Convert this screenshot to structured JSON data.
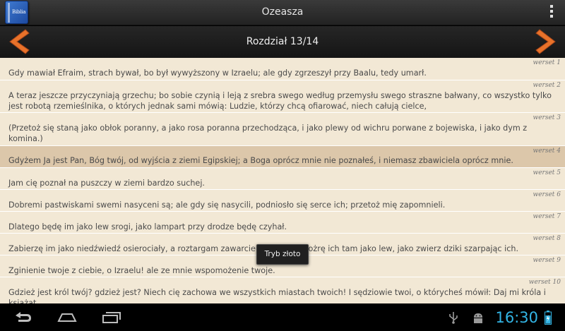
{
  "app": {
    "icon_text": "Biblia",
    "title": "Ozeasza"
  },
  "nav": {
    "chapter": "Rozdział 13/14"
  },
  "verses": [
    {
      "num": "werset 1",
      "text": "Gdy mawiał Efraim, strach bywał, bo był wywyższony w Izraelu; ale gdy zgrzeszył przy Baalu, tedy umarł."
    },
    {
      "num": "werset 2",
      "text": "A teraz jeszcze przyczyniają grzechu; bo sobie czynią i leją z srebra swego według przemysłu swego straszne bałwany, co wszystko tylko jest robotą rzemieślnika, o których jednak sami mówią: Ludzie, którzy chcą ofiarować, niech całują cielce,"
    },
    {
      "num": "werset 3",
      "text": "(Przetoż się staną jako obłok poranny, a jako rosa poranna przechodząca, i jako plewy od wichru porwane z bojewiska, i jako dym z komina.)"
    },
    {
      "num": "werset 4",
      "text": "Gdyżem Ja jest Pan, Bóg twój, od wyjścia z ziemi Egipskiej; a Boga oprócz mnie nie poznałeś, i niemasz zbawiciela oprócz mnie."
    },
    {
      "num": "werset 5",
      "text": "Jam cię poznał na puszczy w ziemi bardzo suchej."
    },
    {
      "num": "werset 6",
      "text": "Dobremi pastwiskami swemi nasyceni są; ale gdy się nasycili, podniosło się serce ich; przetoż mię zapomnieli."
    },
    {
      "num": "werset 7",
      "text": "Dlatego będę im jako lew srogi, jako lampart przy drodze będę czyhał."
    },
    {
      "num": "werset 8",
      "text": "Zabierzę im jako niedźwiedź osierociały, a roztargam zawarcie serca ich; i pożrę ich tam jako lew, jako zwierz dziki szarpając ich."
    },
    {
      "num": "werset 9",
      "text": "Zginienie twoje z ciebie, o Izraelu! ale ze mnie wspomożenie twoje."
    },
    {
      "num": "werset 10",
      "text": "Gdzież jest król twój? gdzież jest? Niech cię zachowa we wszystkich miastach twoich! I sędziowie twoi, o którycheś mówił: Daj mi króla i książąt."
    }
  ],
  "selected_verse_index": 3,
  "toast": {
    "text": "Tryb złoto"
  },
  "system": {
    "clock": "16:30"
  },
  "colors": {
    "accent_clock": "#33b5e5",
    "nav_arrow": "#e8722a",
    "content_bg": "#f2e8d5",
    "selected_bg": "#dcc7aa"
  },
  "icons": {
    "app": "bible-app-icon",
    "overflow": "overflow-menu-icon",
    "prev": "arrow-left-icon",
    "next": "arrow-right-icon",
    "back": "back-icon",
    "home": "home-icon",
    "recents": "recent-apps-icon",
    "usb": "usb-icon",
    "debug": "android-debug-icon",
    "battery": "battery-icon"
  }
}
